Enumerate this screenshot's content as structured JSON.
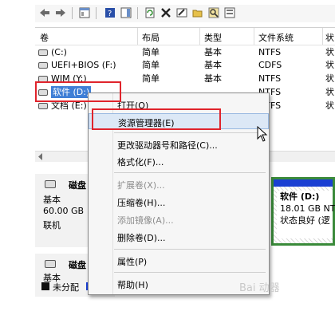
{
  "columns": [
    "卷",
    "布局",
    "类型",
    "文件系统",
    "状"
  ],
  "volumes": [
    {
      "name": "(C:)",
      "layout": "简单",
      "type": "基本",
      "fs": "NTFS",
      "status": "状"
    },
    {
      "name": "UEFI+BIOS (F:)",
      "layout": "简单",
      "type": "基本",
      "fs": "CDFS",
      "status": "状"
    },
    {
      "name": "WIM (Y:)",
      "layout": "简单",
      "type": "基本",
      "fs": "NTFS",
      "status": "状"
    },
    {
      "name": "软件 (D:)",
      "layout": "",
      "type": "",
      "fs": "NTFS",
      "status": "状"
    },
    {
      "name": "文档 (E:)",
      "layout": "",
      "type": "",
      "fs": "NTFS",
      "status": "状"
    }
  ],
  "disk0": {
    "name": "磁盘",
    "type": "基本",
    "size": "60.00 GB",
    "status": "联机"
  },
  "disk1": {
    "name": "磁盘",
    "type": "基本"
  },
  "partition_d": {
    "name": "软件 (D:)",
    "size": "18.01 GB NT",
    "status": "状态良好 (逻"
  },
  "legend": {
    "unallocated": "未分配"
  },
  "context_menu": {
    "open": "打开(O)",
    "explorer": "资源管理器(E)",
    "change_letter": "更改驱动器号和路径(C)...",
    "format": "格式化(F)...",
    "extend": "扩展卷(X)...",
    "shrink": "压缩卷(H)...",
    "mirror": "添加镜像(A)...",
    "delete": "删除卷(D)...",
    "properties": "属性(P)",
    "help": "帮助(H)"
  },
  "watermark": "Bai 动器",
  "colors": {
    "highlight_box": "#e0242c",
    "primary_partition": "#1a3fd2",
    "selection_border": "#3a8a3a",
    "menu_highlight": "#dce8f6"
  }
}
